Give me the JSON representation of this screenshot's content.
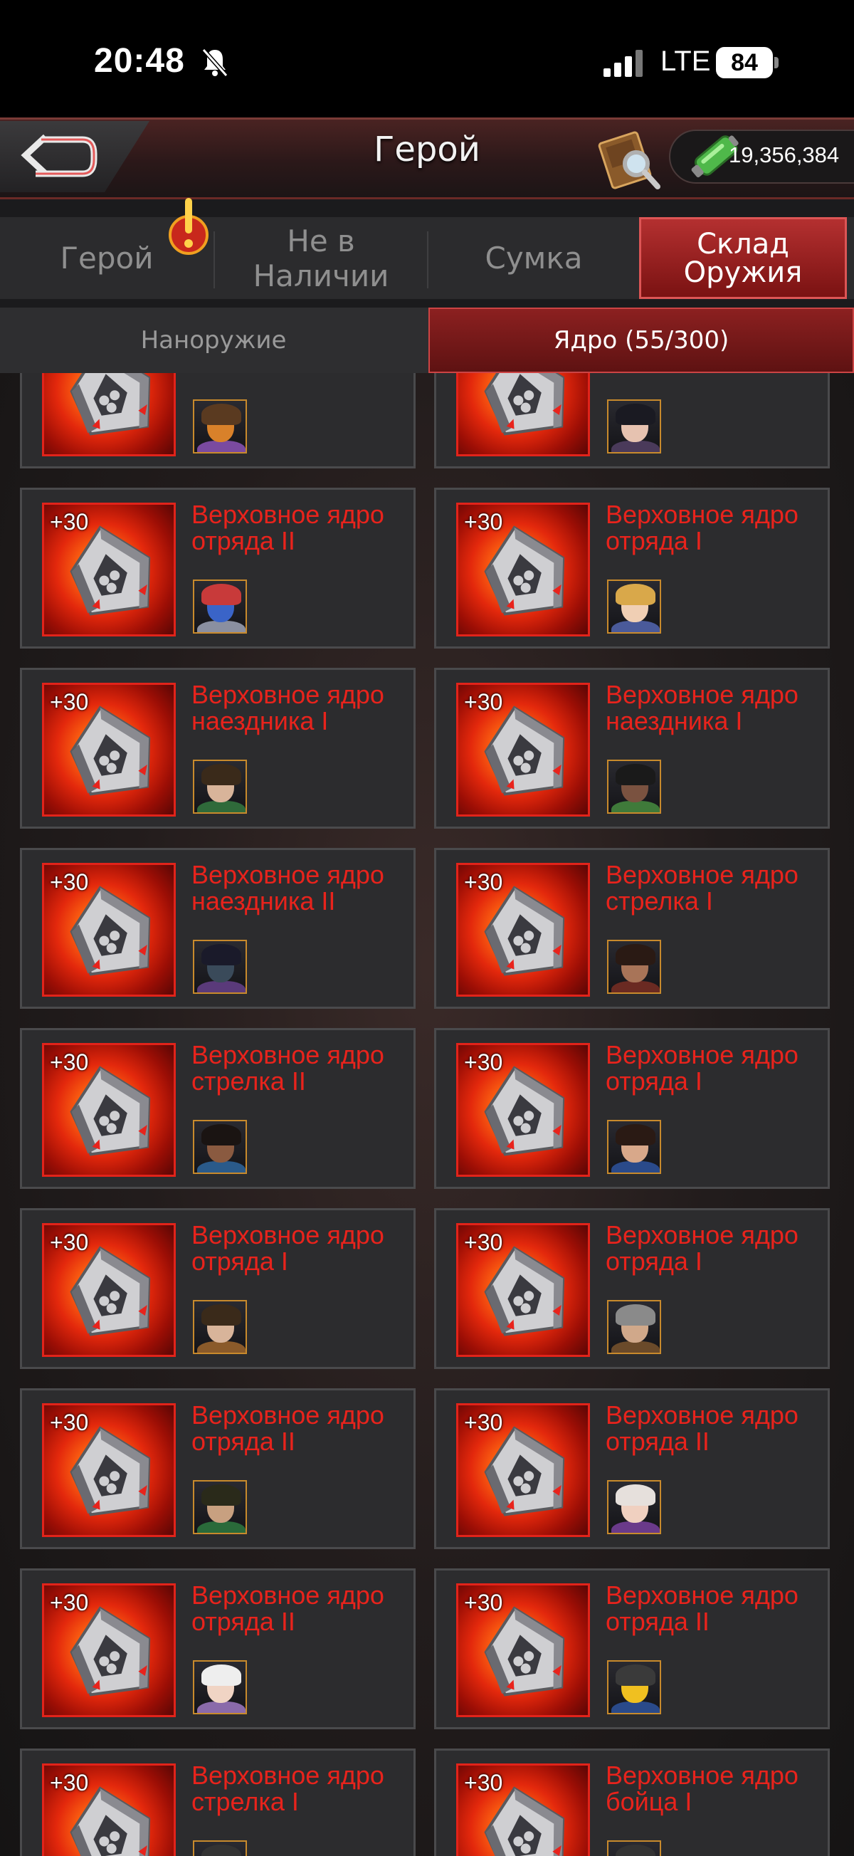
{
  "status_bar": {
    "time": "20:48",
    "network": "LTE",
    "battery": "84"
  },
  "header": {
    "title": "Герой",
    "resource_value": "19,356,384"
  },
  "tabs": [
    {
      "label": "Герой",
      "active": false
    },
    {
      "label": "Не в Наличии",
      "active": false
    },
    {
      "label": "Сумка",
      "active": false
    },
    {
      "label": "Склад Оружия",
      "active": true
    }
  ],
  "subtabs": [
    {
      "label": "Наноружие",
      "active": false
    },
    {
      "label": "Ядро (55/300)",
      "active": true
    }
  ],
  "colors": {
    "accent_red": "#e8231c",
    "tab_active": "#a02222"
  },
  "items": [
    {
      "level": "",
      "name": "",
      "avatar": "robot-orange-icon"
    },
    {
      "level": "",
      "name": "",
      "avatar": "woman-dark-hair-icon"
    },
    {
      "level": "+30",
      "name": "Верховное ядро отряда II",
      "avatar": "robot-blue-red-icon"
    },
    {
      "level": "+30",
      "name": "Верховное ядро отряда I",
      "avatar": "woman-blonde-icon"
    },
    {
      "level": "+30",
      "name": "Верховное ядро наездника I",
      "avatar": "man-green-icon"
    },
    {
      "level": "+30",
      "name": "Верховное ядро наездника I",
      "avatar": "man-glasses-icon"
    },
    {
      "level": "+30",
      "name": "Верховное ядро наездника II",
      "avatar": "masked-hood-icon"
    },
    {
      "level": "+30",
      "name": "Верховное ядро стрелка I",
      "avatar": "woman-dark-icon"
    },
    {
      "level": "+30",
      "name": "Верховное ядро стрелка II",
      "avatar": "man-dark-icon"
    },
    {
      "level": "+30",
      "name": "Верховное ядро отряда I",
      "avatar": "woman-brunette-icon"
    },
    {
      "level": "+30",
      "name": "Верховное ядро отряда I",
      "avatar": "man-sunglasses-icon"
    },
    {
      "level": "+30",
      "name": "Верховное ядро отряда I",
      "avatar": "man-grey-beard-icon"
    },
    {
      "level": "+30",
      "name": "Верховное ядро отряда II",
      "avatar": "man-soldier-icon"
    },
    {
      "level": "+30",
      "name": "Верховное ядро отряда II",
      "avatar": "woman-purple-icon"
    },
    {
      "level": "+30",
      "name": "Верховное ядро отряда II",
      "avatar": "woman-white-hair-icon"
    },
    {
      "level": "+30",
      "name": "Верховное ядро отряда II",
      "avatar": "robot-yellow-icon"
    },
    {
      "level": "+30",
      "name": "Верховное ядро стрелка I",
      "avatar": ""
    },
    {
      "level": "+30",
      "name": "Верховное ядро бойца I",
      "avatar": ""
    }
  ]
}
